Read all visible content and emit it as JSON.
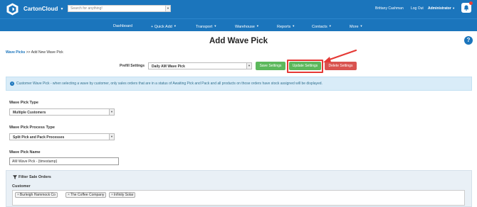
{
  "header": {
    "brand": "CartonCloud",
    "search_placeholder": "Search for anything!",
    "user_name": "Brittany Cashman",
    "logout": "Log Out",
    "role": "Administrator"
  },
  "nav": [
    {
      "label": "Dashboard",
      "caret": false
    },
    {
      "label": "+ Quick Add",
      "caret": true
    },
    {
      "label": "Transport",
      "caret": true
    },
    {
      "label": "Warehouse",
      "caret": true
    },
    {
      "label": "Reports",
      "caret": true
    },
    {
      "label": "Contacts",
      "caret": true
    },
    {
      "label": "More",
      "caret": true
    }
  ],
  "page": {
    "title": "Add Wave Pick",
    "help": "?",
    "breadcrumb_link": "Wave Picks",
    "breadcrumb_sep": " >> ",
    "breadcrumb_current": "Add New Wave Pick"
  },
  "prefill": {
    "label": "Prefill Settings",
    "value": "Daily AM Wave Pick",
    "save": "Save Settings",
    "update": "Update Settings",
    "delete": "Delete Settings"
  },
  "info": {
    "icon": "i",
    "text": "Customer Wave Pick - when selecting a wave by customer, only sales orders that are in a status of Awaiting Pick and Pack and all products on those orders have stock assigned will be displayed."
  },
  "form": {
    "type_label": "Wave Pick Type",
    "type_value": "Multiple Customers",
    "process_label": "Wave Pick Process Type",
    "process_value": "Split Pick and Pack Processes",
    "name_label": "Wave Pick Name",
    "name_value": "AM Wave Pick - {timestamp}"
  },
  "filter": {
    "title": "Filter Sale Orders",
    "customer_label": "Customer",
    "customers": [
      "Burleigh Hammock Co",
      "The Coffee Company",
      "Infinity Solar"
    ]
  },
  "colors": {
    "brand_blue": "#1b75bc",
    "success": "#5cb85c",
    "danger": "#d9534f",
    "annotation": "#e53935"
  }
}
